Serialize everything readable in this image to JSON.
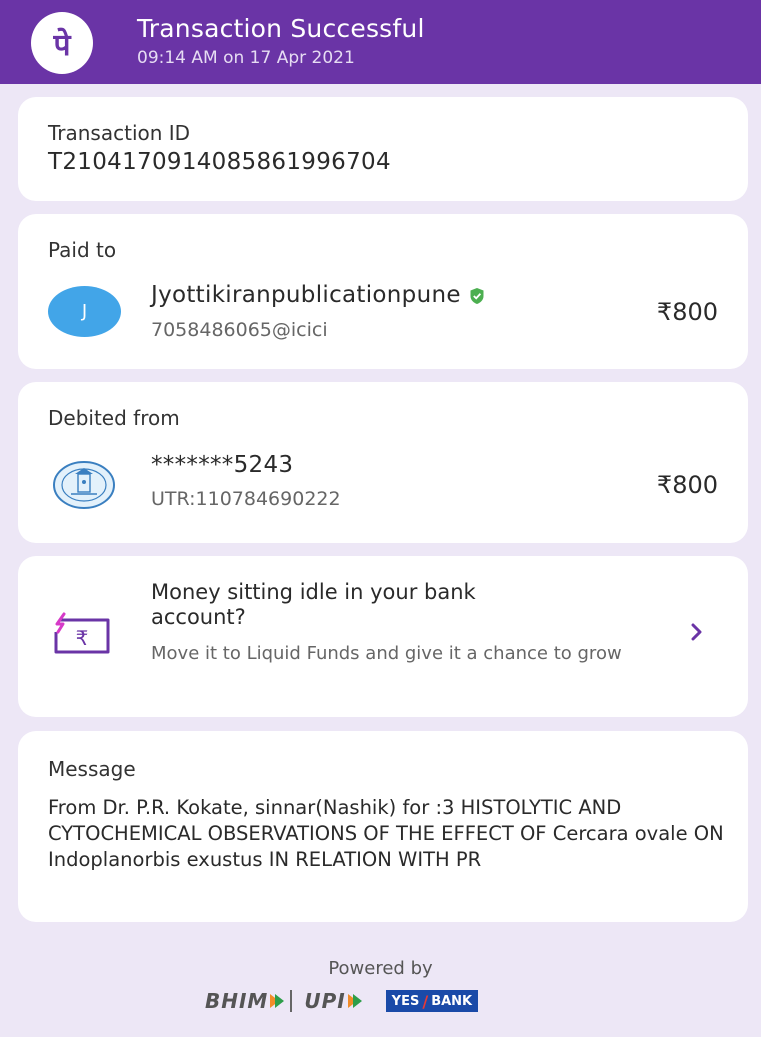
{
  "header": {
    "title": "Transaction Successful",
    "time": "09:14 AM on 17 Apr 2021",
    "logo_glyph": "पे",
    "bg_color": "#6a34a6"
  },
  "transaction": {
    "label": "Transaction ID",
    "id": "T2104170914085861996704"
  },
  "paid_to": {
    "label": "Paid to",
    "avatar_letter": "J",
    "name": "Jyottikiranpublicationpune",
    "upi_id": "7058486065@icici",
    "amount": "₹800",
    "verified_icon": "verified-shield-icon"
  },
  "debited_from": {
    "label": "Debited from",
    "account": "*******5243",
    "utr": "UTR:110784690222",
    "amount": "₹800",
    "bank_icon": "bank-logo-icon"
  },
  "promo": {
    "title": "Money sitting idle in your bank account?",
    "subtitle": "Move it to Liquid Funds and give it a chance to grow",
    "icon": "liquid-funds-icon",
    "arrow_icon": "chevron-right-icon"
  },
  "message": {
    "label": "Message",
    "text": "From Dr. P.R. Kokate, sinnar(Nashik) for :3 HISTOLYTIC AND CYTOCHEMICAL OBSERVATIONS OF THE EFFECT OF Cercara ovale ON Indoplanorbis exustus IN RELATION WITH PR"
  },
  "footer": {
    "powered_by": "Powered by",
    "bhim": "BHIM",
    "upi": "UPI",
    "yes": "YES",
    "bank": "BANK"
  }
}
